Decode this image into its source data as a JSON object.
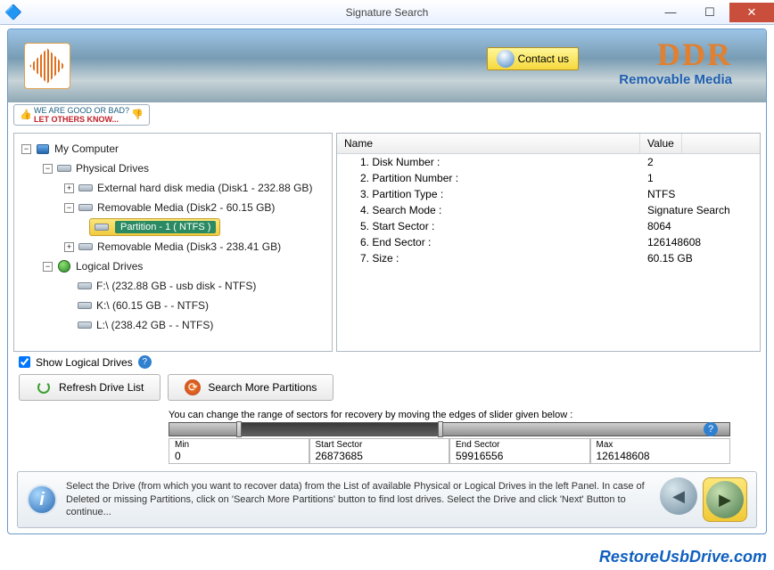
{
  "window": {
    "title": "Signature Search"
  },
  "banner": {
    "contact": "Contact us",
    "brand": "DDR",
    "subtitle": "Removable Media"
  },
  "feedback": {
    "line1": "WE ARE GOOD OR BAD?",
    "line2": "LET OTHERS KNOW..."
  },
  "tree": {
    "root": "My Computer",
    "physical": "Physical Drives",
    "ext": "External hard disk media (Disk1 - 232.88 GB)",
    "rem2": "Removable Media (Disk2 - 60.15 GB)",
    "partition": "Partition - 1 ( NTFS )",
    "rem3": "Removable Media (Disk3 - 238.41 GB)",
    "logical": "Logical Drives",
    "f": "F:\\ (232.88 GB - usb disk - NTFS)",
    "k": "K:\\ (60.15 GB -  - NTFS)",
    "l": "L:\\ (238.42 GB -  - NTFS)"
  },
  "props": {
    "hdr_name": "Name",
    "hdr_value": "Value",
    "rows": [
      {
        "n": "1. Disk Number :",
        "v": "2"
      },
      {
        "n": "2. Partition Number :",
        "v": "1"
      },
      {
        "n": "3. Partition Type :",
        "v": "NTFS"
      },
      {
        "n": "4. Search Mode :",
        "v": "Signature Search"
      },
      {
        "n": "5. Start Sector :",
        "v": "8064"
      },
      {
        "n": "6. End Sector :",
        "v": "126148608"
      },
      {
        "n": "7. Size :",
        "v": "60.15 GB"
      }
    ]
  },
  "controls": {
    "show_logical": "Show Logical Drives",
    "refresh": "Refresh Drive List",
    "search_more": "Search More Partitions"
  },
  "slider": {
    "label": "You can change the range of sectors for recovery by moving the edges of slider given below :",
    "min_lbl": "Min",
    "min": "0",
    "start_lbl": "Start Sector",
    "start": "26873685",
    "end_lbl": "End Sector",
    "end": "59916556",
    "max_lbl": "Max",
    "max": "126148608"
  },
  "footer": {
    "text": "Select the Drive (from which you want to recover data) from the List of available Physical or Logical Drives in the left Panel. In case of Deleted or missing Partitions, click on 'Search More Partitions' button to find lost drives. Select the Drive and click 'Next' Button to continue..."
  },
  "watermark": "RestoreUsbDrive.com"
}
